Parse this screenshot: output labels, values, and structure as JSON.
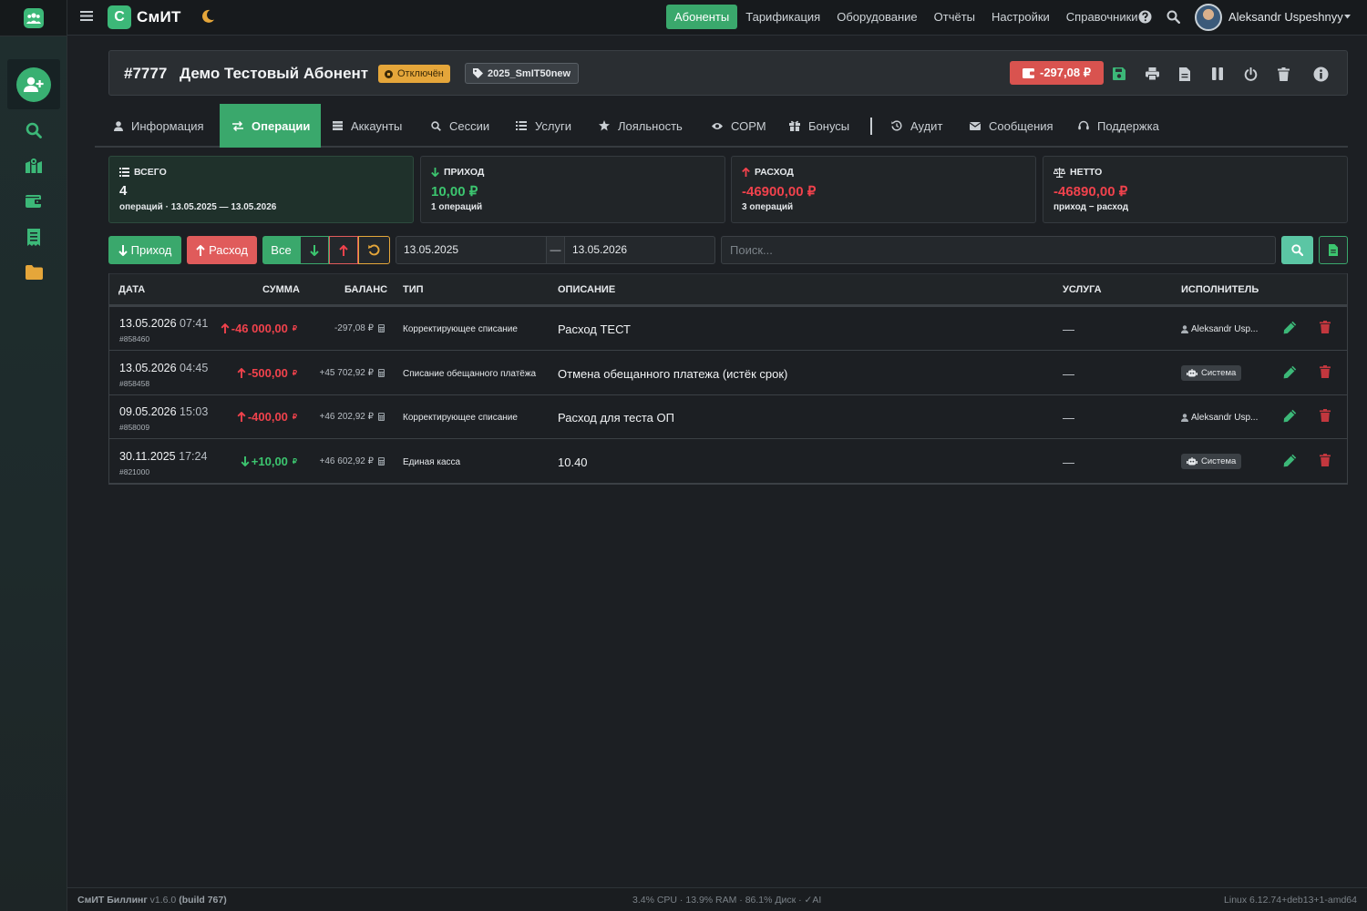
{
  "app": {
    "brand_letter": "С",
    "brand_name": "СмИТ"
  },
  "topnav": {
    "items": [
      {
        "label": "Абоненты",
        "active": true
      },
      {
        "label": "Тарификация"
      },
      {
        "label": "Оборудование"
      },
      {
        "label": "Отчёты"
      },
      {
        "label": "Настройки"
      },
      {
        "label": "Справочники"
      }
    ],
    "user_name": "Aleksandr Uspeshnyy"
  },
  "subscriber": {
    "id": "#7777",
    "name": "Демо Тестовый Абонент",
    "status": "Отключён",
    "tariff": "2025_SmIT50new",
    "balance": "-297,08 ₽"
  },
  "tabs": [
    {
      "label": "Информация",
      "icon": "user-icon"
    },
    {
      "label": "Операции",
      "icon": "exchange-icon",
      "active": true
    },
    {
      "label": "Аккаунты",
      "icon": "server-icon"
    },
    {
      "label": "Сессии",
      "icon": "search-icon"
    },
    {
      "label": "Услуги",
      "icon": "list-icon"
    },
    {
      "label": "Лояльность",
      "icon": "star-icon"
    },
    {
      "label": "СОРМ",
      "icon": "eye-icon"
    },
    {
      "label": "Бонусы",
      "icon": "gift-icon"
    },
    {
      "label": "Аудит",
      "icon": "history-icon"
    },
    {
      "label": "Сообщения",
      "icon": "envelope-icon"
    },
    {
      "label": "Поддержка",
      "icon": "headset-icon"
    }
  ],
  "stats": {
    "total": {
      "label": "Всего",
      "value": "4",
      "sub": "операций · 13.05.2025 — 13.05.2026"
    },
    "income": {
      "label": "Приход",
      "value": "10,00 ₽",
      "sub": "1 операций"
    },
    "expense": {
      "label": "Расход",
      "value": "-46900,00 ₽",
      "sub": "3 операций"
    },
    "net": {
      "label": "Нетто",
      "value": "-46890,00 ₽",
      "sub": "приход − расход"
    }
  },
  "filters": {
    "income_label": "Приход",
    "expense_label": "Расход",
    "all_label": "Все",
    "date_from": "13.05.2025",
    "date_sep": "—",
    "date_to": "13.05.2026",
    "search_placeholder": "Поиск..."
  },
  "table": {
    "headers": {
      "date": "Дата",
      "amount": "Сумма",
      "balance": "Баланс",
      "type": "Тип",
      "description": "Описание",
      "service": "Услуга",
      "executor": "Исполнитель"
    },
    "rows": [
      {
        "date": "13.05.2026",
        "time": "07:41",
        "op_id": "#858460",
        "direction": "out",
        "amount": "-46 000,00",
        "currency": "₽",
        "balance": "-297,08 ₽",
        "type": "Корректирующее списание",
        "description": "Расход ТЕСТ",
        "service": "—",
        "executor": "Aleksandr Usp...",
        "executor_kind": "user"
      },
      {
        "date": "13.05.2026",
        "time": "04:45",
        "op_id": "#858458",
        "direction": "out",
        "amount": "-500,00",
        "currency": "₽",
        "balance": "+45 702,92 ₽",
        "type": "Списание обещанного платёжа",
        "description": "Отмена обещанного платежа (истёк срок)",
        "service": "—",
        "executor": "Система",
        "executor_kind": "system"
      },
      {
        "date": "09.05.2026",
        "time": "15:03",
        "op_id": "#858009",
        "direction": "out",
        "amount": "-400,00",
        "currency": "₽",
        "balance": "+46 202,92 ₽",
        "type": "Корректирующее списание",
        "description": "Расход для теста ОП",
        "service": "—",
        "executor": "Aleksandr Usp...",
        "executor_kind": "user"
      },
      {
        "date": "30.11.2025",
        "time": "17:24",
        "op_id": "#821000",
        "direction": "in",
        "amount": "+10,00",
        "currency": "₽",
        "balance": "+46 602,92 ₽",
        "type": "Единая касса",
        "description": "10.40",
        "service": "—",
        "executor": "Система",
        "executor_kind": "system"
      }
    ]
  },
  "footer": {
    "app_name": "СмИТ Биллинг",
    "version": "v1.6.0",
    "build": "(build 767)",
    "stats": "3.4% CPU · 13.9% RAM · 86.1% Диск · ✓AI",
    "os": "Linux 6.12.74+deb13+1-amd64"
  },
  "colors": {
    "accent": "#3aa86c",
    "danger": "#d9534f",
    "warning": "#e5a63a",
    "income": "#3cc56f",
    "expense": "#f0424c"
  }
}
